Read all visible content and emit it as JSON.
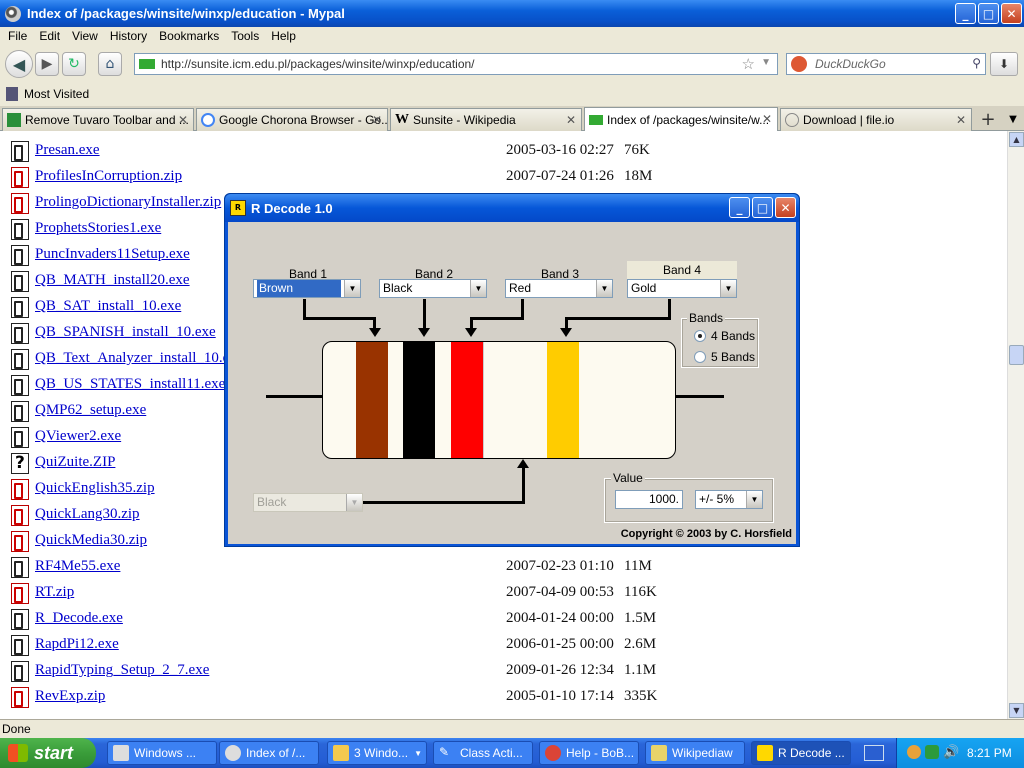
{
  "browser": {
    "title": "Index of /packages/winsite/winxp/education - Mypal",
    "window_buttons": {
      "minimize": "_",
      "maximize": "□",
      "close": "✕"
    },
    "menu": [
      "File",
      "Edit",
      "View",
      "History",
      "Bookmarks",
      "Tools",
      "Help"
    ],
    "url": "http://sunsite.icm.edu.pl/packages/winsite/winxp/education/",
    "search_placeholder": "DuckDuckGo",
    "bookmarks_item": "Most Visited",
    "tabs": [
      {
        "label": "Remove Tuvaro Toolbar and ..."
      },
      {
        "label": "Google Chorona Browser - Go..."
      },
      {
        "label": "Sunsite - Wikipedia"
      },
      {
        "label": "Index of /packages/winsite/w..."
      },
      {
        "label": "Download | file.io"
      }
    ],
    "status": "Done"
  },
  "listing": {
    "rows": [
      {
        "name": "Presan.exe",
        "date": "2005-03-16 02:27",
        "size": "76K",
        "type": "exe"
      },
      {
        "name": "ProfilesInCorruption.zip",
        "date": "2007-07-24 01:26",
        "size": "18M",
        "type": "zip"
      },
      {
        "name": "ProlingoDictionaryInstaller.zip",
        "date": "",
        "size": "",
        "type": "zip"
      },
      {
        "name": "ProphetsStories1.exe",
        "date": "",
        "size": "",
        "type": "exe"
      },
      {
        "name": "PuncInvaders11Setup.exe",
        "date": "",
        "size": "",
        "type": "exe"
      },
      {
        "name": "QB_MATH_install20.exe",
        "date": "",
        "size": "",
        "type": "exe"
      },
      {
        "name": "QB_SAT_install_10.exe",
        "date": "",
        "size": "",
        "type": "exe"
      },
      {
        "name": "QB_SPANISH_install_10.exe",
        "date": "",
        "size": "",
        "type": "exe"
      },
      {
        "name": "QB_Text_Analyzer_install_10.e",
        "date": "",
        "size": "",
        "type": "exe"
      },
      {
        "name": "QB_US_STATES_install11.exe",
        "date": "",
        "size": "",
        "type": "exe"
      },
      {
        "name": "QMP62_setup.exe",
        "date": "",
        "size": "",
        "type": "exe"
      },
      {
        "name": "QViewer2.exe",
        "date": "",
        "size": "",
        "type": "exe"
      },
      {
        "name": "QuiZuite.ZIP",
        "date": "",
        "size": "",
        "type": "unknown"
      },
      {
        "name": "QuickEnglish35.zip",
        "date": "",
        "size": "",
        "type": "zip"
      },
      {
        "name": "QuickLang30.zip",
        "date": "",
        "size": "",
        "type": "zip"
      },
      {
        "name": "QuickMedia30.zip",
        "date": "",
        "size": "",
        "type": "zip"
      },
      {
        "name": "RF4Me55.exe",
        "date": "2007-02-23 01:10",
        "size": "11M",
        "type": "exe"
      },
      {
        "name": "RT.zip",
        "date": "2007-04-09 00:53",
        "size": "116K",
        "type": "zip"
      },
      {
        "name": "R_Decode.exe",
        "date": "2004-01-24 00:00",
        "size": "1.5M",
        "type": "exe"
      },
      {
        "name": "RapdPi12.exe",
        "date": "2006-01-25 00:00",
        "size": "2.6M",
        "type": "exe"
      },
      {
        "name": "RapidTyping_Setup_2_7.exe",
        "date": "2009-01-26 12:34",
        "size": "1.1M",
        "type": "exe"
      },
      {
        "name": "RevExp.zip",
        "date": "2005-01-10 17:14",
        "size": "335K",
        "type": "zip"
      }
    ]
  },
  "dialog": {
    "title": "R Decode 1.0",
    "band_labels": [
      "Band 1",
      "Band 2",
      "Band 3",
      "Band 4"
    ],
    "band_values": [
      "Brown",
      "Black",
      "Red",
      "Gold"
    ],
    "band5_value": "Black",
    "bands_group": {
      "label": "Bands",
      "options": [
        "4 Bands",
        "5 Bands"
      ],
      "selected": 0
    },
    "value_group": {
      "label": "Value",
      "value": "1000.",
      "tolerance": "+/-  5%"
    },
    "copyright": "Copyright © 2003 by C. Horsfield",
    "colors": {
      "brown": "#993300",
      "black": "#000000",
      "red": "#ff0000",
      "gold": "#ffcc00",
      "body": "#fdfaf0"
    }
  },
  "taskbar": {
    "start_label": "start",
    "buttons": [
      "Windows ...",
      "Index of /...",
      "3 Windo...",
      "Class Acti...",
      "Help - BoB...",
      "Wikipediaw",
      "R Decode ..."
    ],
    "clock": "8:21 PM"
  }
}
